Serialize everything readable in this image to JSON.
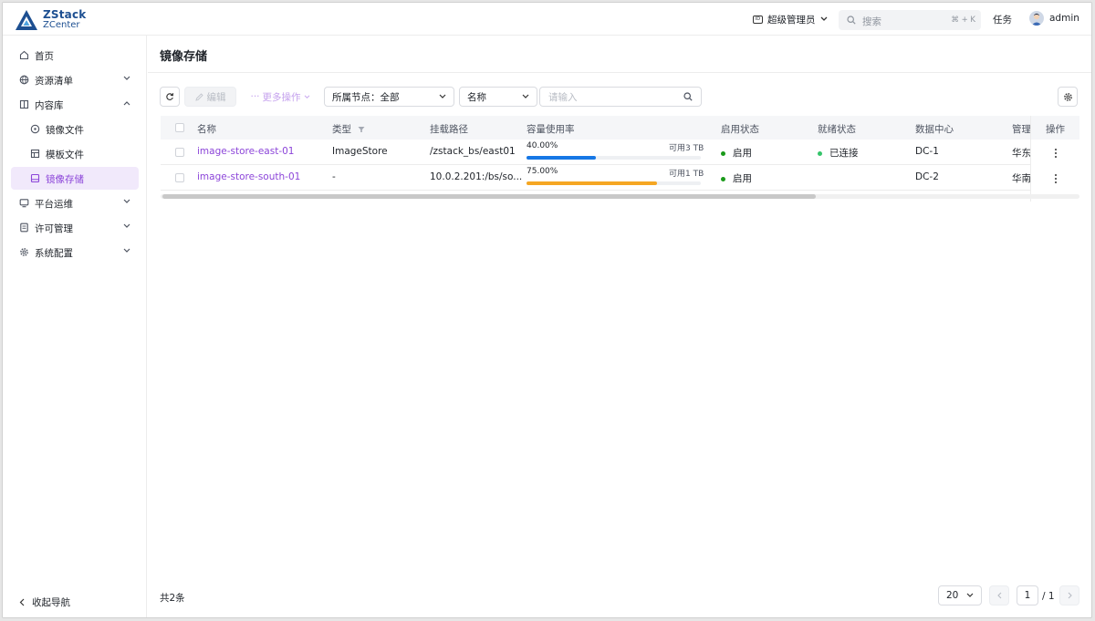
{
  "header": {
    "logo_line1": "ZStack",
    "logo_line2": "ZCenter",
    "role_label": "超级管理员",
    "search_placeholder": "搜索",
    "search_shortcut": "⌘ + K",
    "tasks_label": "任务",
    "user_name": "admin"
  },
  "sidebar": {
    "items": [
      {
        "label": "首页",
        "icon": "home-icon"
      },
      {
        "label": "资源清单",
        "icon": "globe-icon"
      },
      {
        "label": "内容库",
        "icon": "book-icon"
      },
      {
        "label": "镜像文件",
        "icon": "disc-icon"
      },
      {
        "label": "模板文件",
        "icon": "template-icon"
      },
      {
        "label": "镜像存储",
        "icon": "storage-icon"
      },
      {
        "label": "平台运维",
        "icon": "monitor-icon"
      },
      {
        "label": "许可管理",
        "icon": "license-icon"
      },
      {
        "label": "系统配置",
        "icon": "gear-icon"
      }
    ],
    "collapse_label": "收起导航"
  },
  "page": {
    "title": "镜像存储"
  },
  "toolbar": {
    "edit_label": "编辑",
    "more_label": "更多操作",
    "node_filter_label": "所属节点：全部",
    "field_select_label": "名称",
    "input_placeholder": "请输入"
  },
  "table": {
    "columns": [
      "名称",
      "类型",
      "挂载路径",
      "容量使用率",
      "启用状态",
      "就绪状态",
      "数据中心",
      "管理",
      "操作"
    ],
    "rows": [
      {
        "name": "image-store-east-01",
        "type": "ImageStore",
        "mount_path": "/zstack_bs/east01",
        "usage_percent_label": "40.00%",
        "usage_fraction": 0.4,
        "available": "可用3 TB",
        "enable_state": "启用",
        "ready_state": "已连接",
        "datacenter": "DC-1",
        "manage": "华东"
      },
      {
        "name": "image-store-south-01",
        "type": "-",
        "mount_path": "10.0.2.201:/bs/so...",
        "usage_percent_label": "75.00%",
        "usage_fraction": 0.75,
        "available": "可用1 TB",
        "enable_state": "启用",
        "ready_state": "",
        "datacenter": "DC-2",
        "manage": "华南"
      }
    ]
  },
  "footer": {
    "total_label": "共2条",
    "page_size": "20",
    "current_page": "1",
    "total_pages": "/ 1"
  },
  "colors": {
    "accent": "#8c45d9",
    "usage_bar_1": "#1677e5",
    "usage_bar_2": "#f5a623",
    "status_green": "#1a9a1a",
    "ready_green": "#35c46a"
  }
}
